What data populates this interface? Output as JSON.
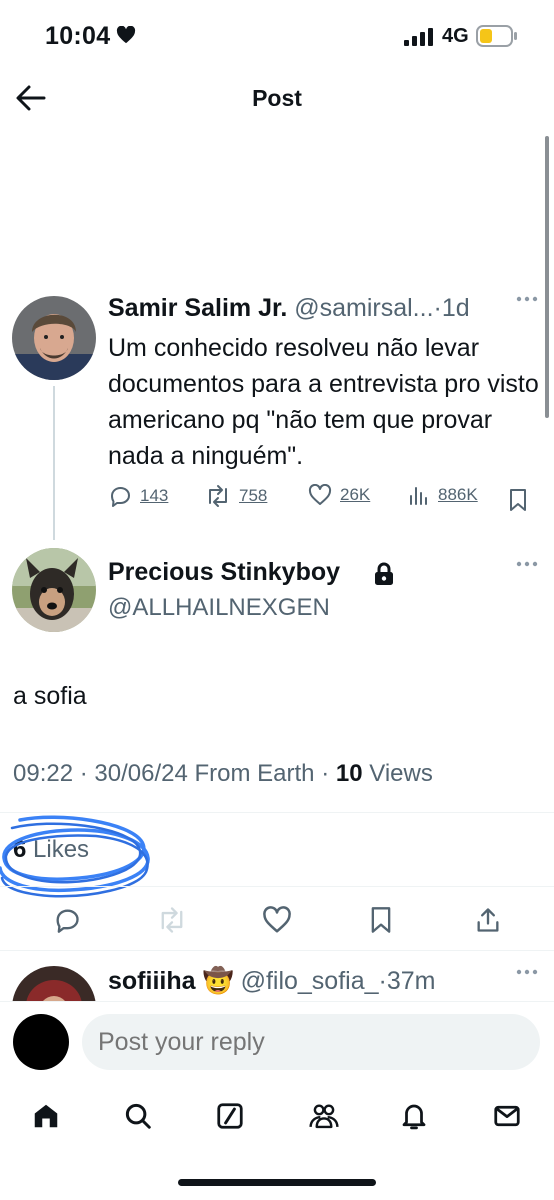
{
  "status_bar": {
    "time": "10:04",
    "network": "4G",
    "signal_icon": "signal-bars-icon",
    "battery_icon": "battery-low-icon"
  },
  "header": {
    "title": "Post",
    "back_icon": "arrow-left-icon"
  },
  "parent_post": {
    "name": "Samir Salim Jr.",
    "handle": "@samirsal...",
    "separator": "·",
    "age": "1d",
    "text": "Um conhecido resolveu não levar documentos para a entrevista pro visto americano pq \"não tem que provar nada a ninguém\".",
    "replies": "143",
    "reposts": "758",
    "likes": "26K",
    "views": "886K"
  },
  "main_post": {
    "name": "Precious Stinkyboy",
    "handle": "@ALLHAILNEXGEN",
    "text": "a sofia",
    "time": "09:22",
    "separator": "·",
    "date": "30/06/24",
    "source": "From Earth",
    "views_count": "10",
    "views_label": "Views",
    "likes_count": "6",
    "likes_label": "Likes"
  },
  "reply_preview": {
    "name": "sofiiiha",
    "emoji": "🤠",
    "handle": "@filo_sofia_",
    "separator": "·",
    "age": "37m"
  },
  "reply_box": {
    "placeholder": "Post your reply"
  },
  "colors": {
    "text": "#0f1419",
    "secondary": "#536471",
    "scribble": "#3b82f6",
    "divider": "#eff3f4"
  }
}
